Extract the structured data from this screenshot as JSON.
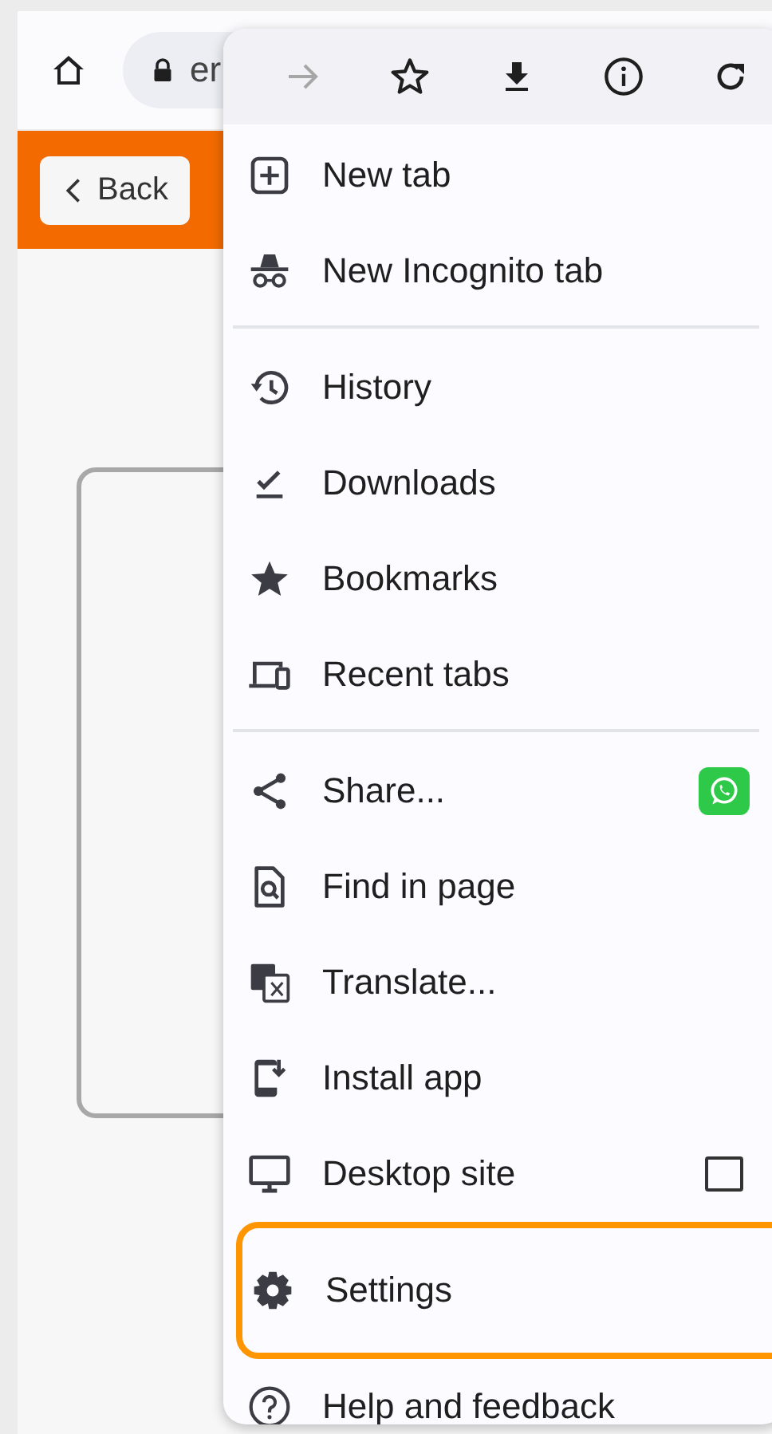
{
  "address_bar": {
    "url": "er"
  },
  "page": {
    "back_button": "Back"
  },
  "menu": {
    "toolbar": [
      {
        "disabled": true
      },
      {
        "disabled": false
      },
      {
        "disabled": false
      },
      {
        "disabled": false
      },
      {
        "disabled": false
      }
    ],
    "sections": [
      [
        {
          "label": "New tab",
          "kind": "plain",
          "highlighted": false
        },
        {
          "label": "New Incognito tab",
          "kind": "plain",
          "highlighted": false
        }
      ],
      [
        {
          "label": "History",
          "kind": "plain",
          "highlighted": false
        },
        {
          "label": "Downloads",
          "kind": "plain",
          "highlighted": false
        },
        {
          "label": "Bookmarks",
          "kind": "plain",
          "highlighted": false
        },
        {
          "label": "Recent tabs",
          "kind": "plain",
          "highlighted": false
        }
      ],
      [
        {
          "label": "Share...",
          "kind": "share",
          "highlighted": false
        },
        {
          "label": "Find in page",
          "kind": "plain",
          "highlighted": false
        },
        {
          "label": "Translate...",
          "kind": "plain",
          "highlighted": false
        },
        {
          "label": "Install app",
          "kind": "plain",
          "highlighted": false
        },
        {
          "label": "Desktop site",
          "kind": "check",
          "checked": false,
          "highlighted": false
        },
        {
          "label": "Settings",
          "kind": "plain",
          "highlighted": true
        },
        {
          "label": "Help and feedback",
          "kind": "plain",
          "highlighted": false
        }
      ]
    ]
  }
}
